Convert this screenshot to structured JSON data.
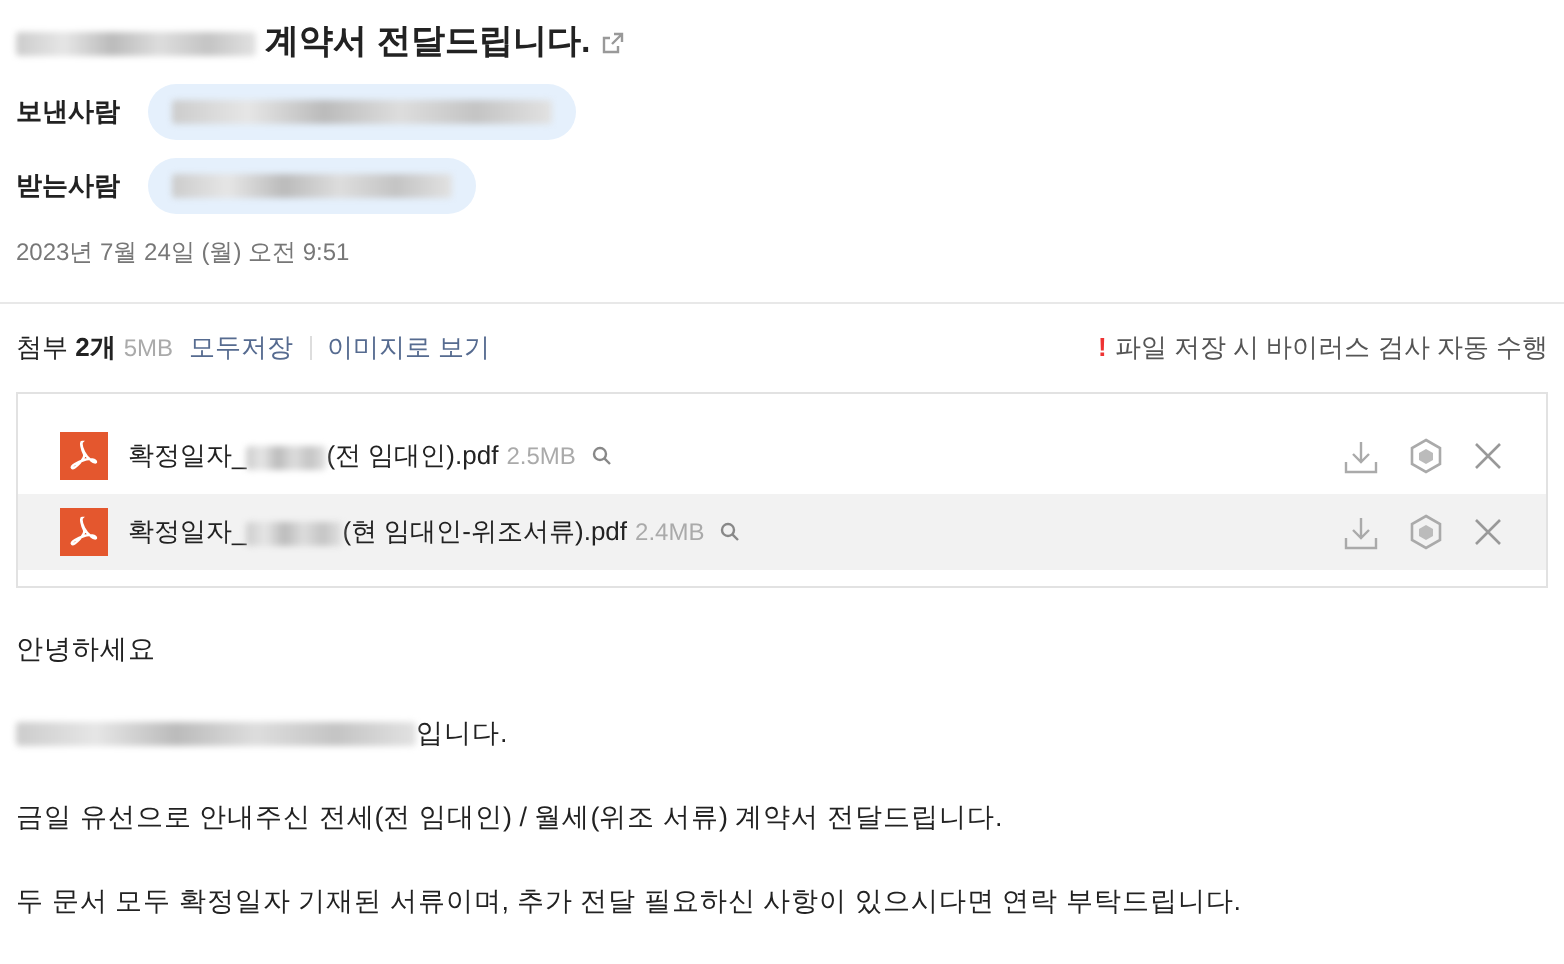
{
  "subject": {
    "text": "계약서 전달드립니다.",
    "redacted_prefix": true
  },
  "sender": {
    "label": "보낸사람",
    "redacted": true
  },
  "recipient": {
    "label": "받는사람",
    "redacted": true
  },
  "date": "2023년 7월 24일 (월) 오전 9:51",
  "attachments_bar": {
    "label": "첨부",
    "count": "2개",
    "size": "5MB",
    "links": [
      "모두저장",
      "이미지로 보기"
    ],
    "warning_mark": "!",
    "warning": "파일 저장 시 바이러스 검사 자동 수행"
  },
  "attachments": [
    {
      "name_prefix": "확정일자_",
      "name_suffix": "(전 임대인).pdf",
      "size": "2.5MB",
      "selected": false
    },
    {
      "name_prefix": "확정일자_",
      "name_suffix": "(현 임대인-위조서류).pdf",
      "size": "2.4MB",
      "selected": true
    }
  ],
  "body": [
    {
      "text": "안녕하세요",
      "redacted_prefix": false
    },
    {
      "text": "입니다.",
      "redacted_prefix": true
    },
    {
      "text": "금일 유선으로 안내주신 전세(전 임대인) / 월세(위조 서류) 계약서 전달드립니다.",
      "redacted_prefix": false
    },
    {
      "text": "두 문서 모두 확정일자 기재된 서류이며, 추가 전달 필요하신 사항이 있으시다면 연락 부탁드립니다.",
      "redacted_prefix": false
    }
  ]
}
